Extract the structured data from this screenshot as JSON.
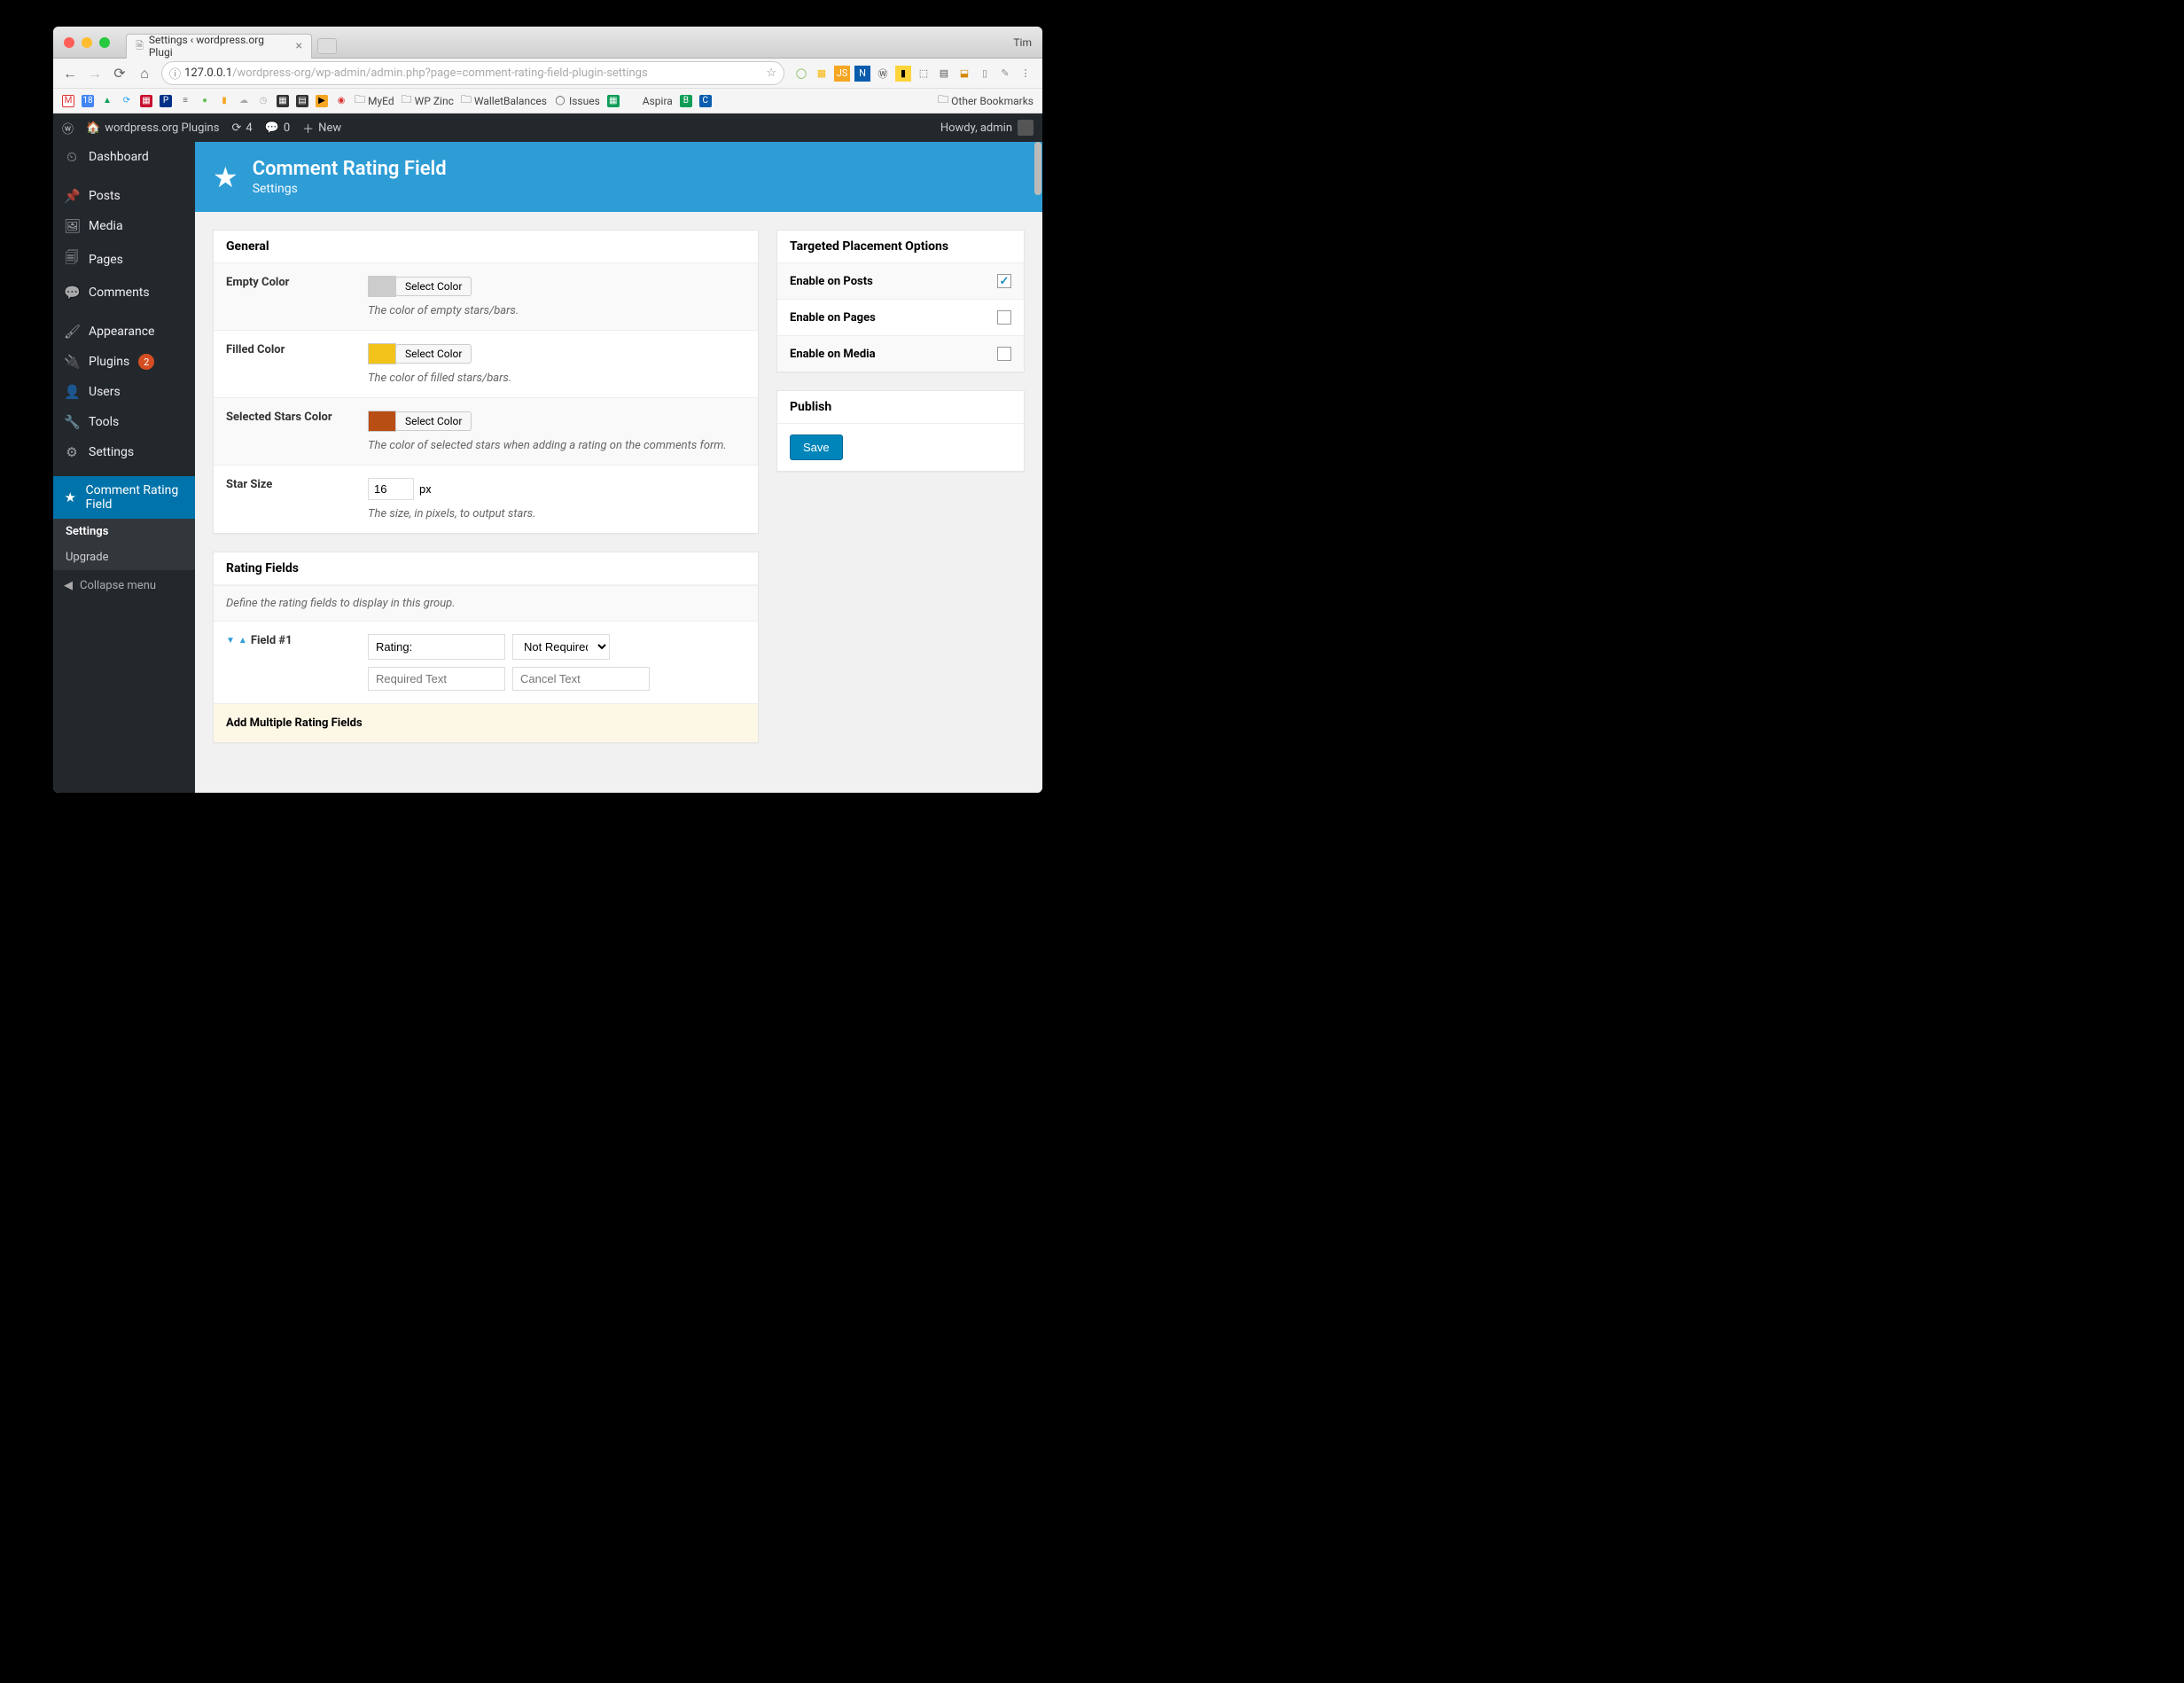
{
  "browser": {
    "user": "Tim",
    "tab_title": "Settings ‹ wordpress.org Plugi",
    "url_host": "127.0.0.1",
    "url_path": "/wordpress-org/wp-admin/admin.php?page=comment-rating-field-plugin-settings",
    "bookmarks_text": {
      "myed": "MyEd",
      "wpzinc": "WP Zinc",
      "wallet": "WalletBalances",
      "issues": "Issues",
      "aspira": "Aspira",
      "other": "Other Bookmarks"
    }
  },
  "adminbar": {
    "site": "wordpress.org Plugins",
    "updates": "4",
    "comments": "0",
    "new": "New",
    "howdy": "Howdy, admin"
  },
  "sidebar": {
    "dashboard": "Dashboard",
    "posts": "Posts",
    "media": "Media",
    "pages": "Pages",
    "comments": "Comments",
    "appearance": "Appearance",
    "plugins": "Plugins",
    "plugins_badge": "2",
    "users": "Users",
    "tools": "Tools",
    "settings": "Settings",
    "crf": "Comment Rating Field",
    "sub_settings": "Settings",
    "sub_upgrade": "Upgrade",
    "collapse": "Collapse menu"
  },
  "header": {
    "title": "Comment Rating Field",
    "subtitle": "Settings"
  },
  "general": {
    "heading": "General",
    "empty_color": {
      "label": "Empty Color",
      "btn": "Select Color",
      "swatch": "#cccccc",
      "desc": "The color of empty stars/bars."
    },
    "filled_color": {
      "label": "Filled Color",
      "btn": "Select Color",
      "swatch": "#f2c31b",
      "desc": "The color of filled stars/bars."
    },
    "selected_color": {
      "label": "Selected Stars Color",
      "btn": "Select Color",
      "swatch": "#b94e14",
      "desc": "The color of selected stars when adding a rating on the comments form."
    },
    "star_size": {
      "label": "Star Size",
      "value": "16",
      "unit": "px",
      "desc": "The size, in pixels, to output stars."
    }
  },
  "rating_fields": {
    "heading": "Rating Fields",
    "intro": "Define the rating fields to display in this group.",
    "field1_label": "Field #1",
    "field1_name": "Rating:",
    "field1_required": "Not Required",
    "field1_required_ph": "Required Text",
    "field1_cancel_ph": "Cancel Text",
    "add_multiple": "Add Multiple Rating Fields"
  },
  "placement": {
    "heading": "Targeted Placement Options",
    "posts": "Enable on Posts",
    "pages": "Enable on Pages",
    "media": "Enable on Media"
  },
  "publish": {
    "heading": "Publish",
    "save": "Save"
  }
}
